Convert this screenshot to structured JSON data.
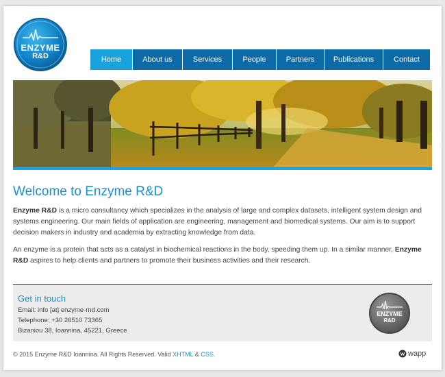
{
  "brand": {
    "logo_line1": "Enzyme",
    "logo_line2": "R&D",
    "accent": "#1aa2dc",
    "nav_color": "#0d6aa6"
  },
  "nav": {
    "items": [
      {
        "label": "Home",
        "active": true
      },
      {
        "label": "About us"
      },
      {
        "label": "Services"
      },
      {
        "label": "People"
      },
      {
        "label": "Partners"
      },
      {
        "label": "Publications"
      },
      {
        "label": "Contact"
      }
    ]
  },
  "main": {
    "title": "Welcome to Enzyme R&D",
    "p1_brand": "Enzyme R&D",
    "p1_text": " is a micro consultancy which specializes in the analysis of large and complex datasets, intelligent system design and systems engineering. Our main fields of application are engineering, management and biomedical systems. Our aim is to support decision makers in industry and academia by extracting knowledge from data.",
    "p2_text": "An enzyme is a protein that acts as a catalyst in biochemical reactions in the body, speeding them up. In a similar manner, ",
    "p2_brand": "Enzyme R&D",
    "p2_tail": " aspires to help clients and partners to promote their business activities and their research."
  },
  "contact": {
    "heading": "Get in touch",
    "email": "Email: info [at] enzyme-rnd.com",
    "phone": "Telephone: +30 26510 73365",
    "address": "Bizaniou 38, Ioannina, 45221, Greece",
    "badge_line1": "Enzyme",
    "badge_line2": "R&D"
  },
  "footer": {
    "text": "© 2015 Enzyme R&D Ioannina. All Rights Reserved. Valid ",
    "xhtml": "XHTML",
    "amp": " & ",
    "css": "CSS",
    "period": ".",
    "credit": "wapp"
  }
}
